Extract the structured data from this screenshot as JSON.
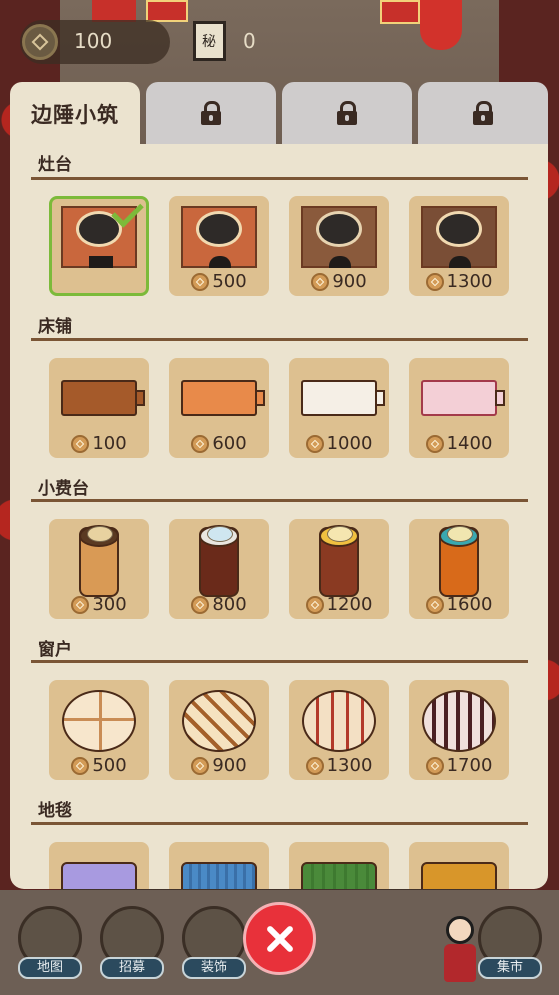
{
  "hud": {
    "coins": "100",
    "books": "0"
  },
  "tabs": [
    {
      "label": "边陲小筑",
      "locked": false
    },
    {
      "label": "",
      "locked": true
    },
    {
      "label": "",
      "locked": true
    },
    {
      "label": "",
      "locked": true
    }
  ],
  "sections": [
    {
      "title": "灶台",
      "items": [
        {
          "price": "",
          "selected": true
        },
        {
          "price": "500"
        },
        {
          "price": "900"
        },
        {
          "price": "1300"
        }
      ]
    },
    {
      "title": "床铺",
      "items": [
        {
          "price": "100"
        },
        {
          "price": "600"
        },
        {
          "price": "1000"
        },
        {
          "price": "1400"
        }
      ]
    },
    {
      "title": "小费台",
      "items": [
        {
          "price": "300"
        },
        {
          "price": "800"
        },
        {
          "price": "1200"
        },
        {
          "price": "1600"
        }
      ]
    },
    {
      "title": "窗户",
      "items": [
        {
          "price": "500"
        },
        {
          "price": "900"
        },
        {
          "price": "1300"
        },
        {
          "price": "1700"
        }
      ]
    },
    {
      "title": "地毯",
      "items": [
        {
          "price": ""
        },
        {
          "price": ""
        },
        {
          "price": ""
        },
        {
          "price": ""
        }
      ]
    }
  ],
  "nav": [
    {
      "label": "地图"
    },
    {
      "label": "招募"
    },
    {
      "label": "装饰"
    },
    {
      "label": "集市"
    }
  ]
}
